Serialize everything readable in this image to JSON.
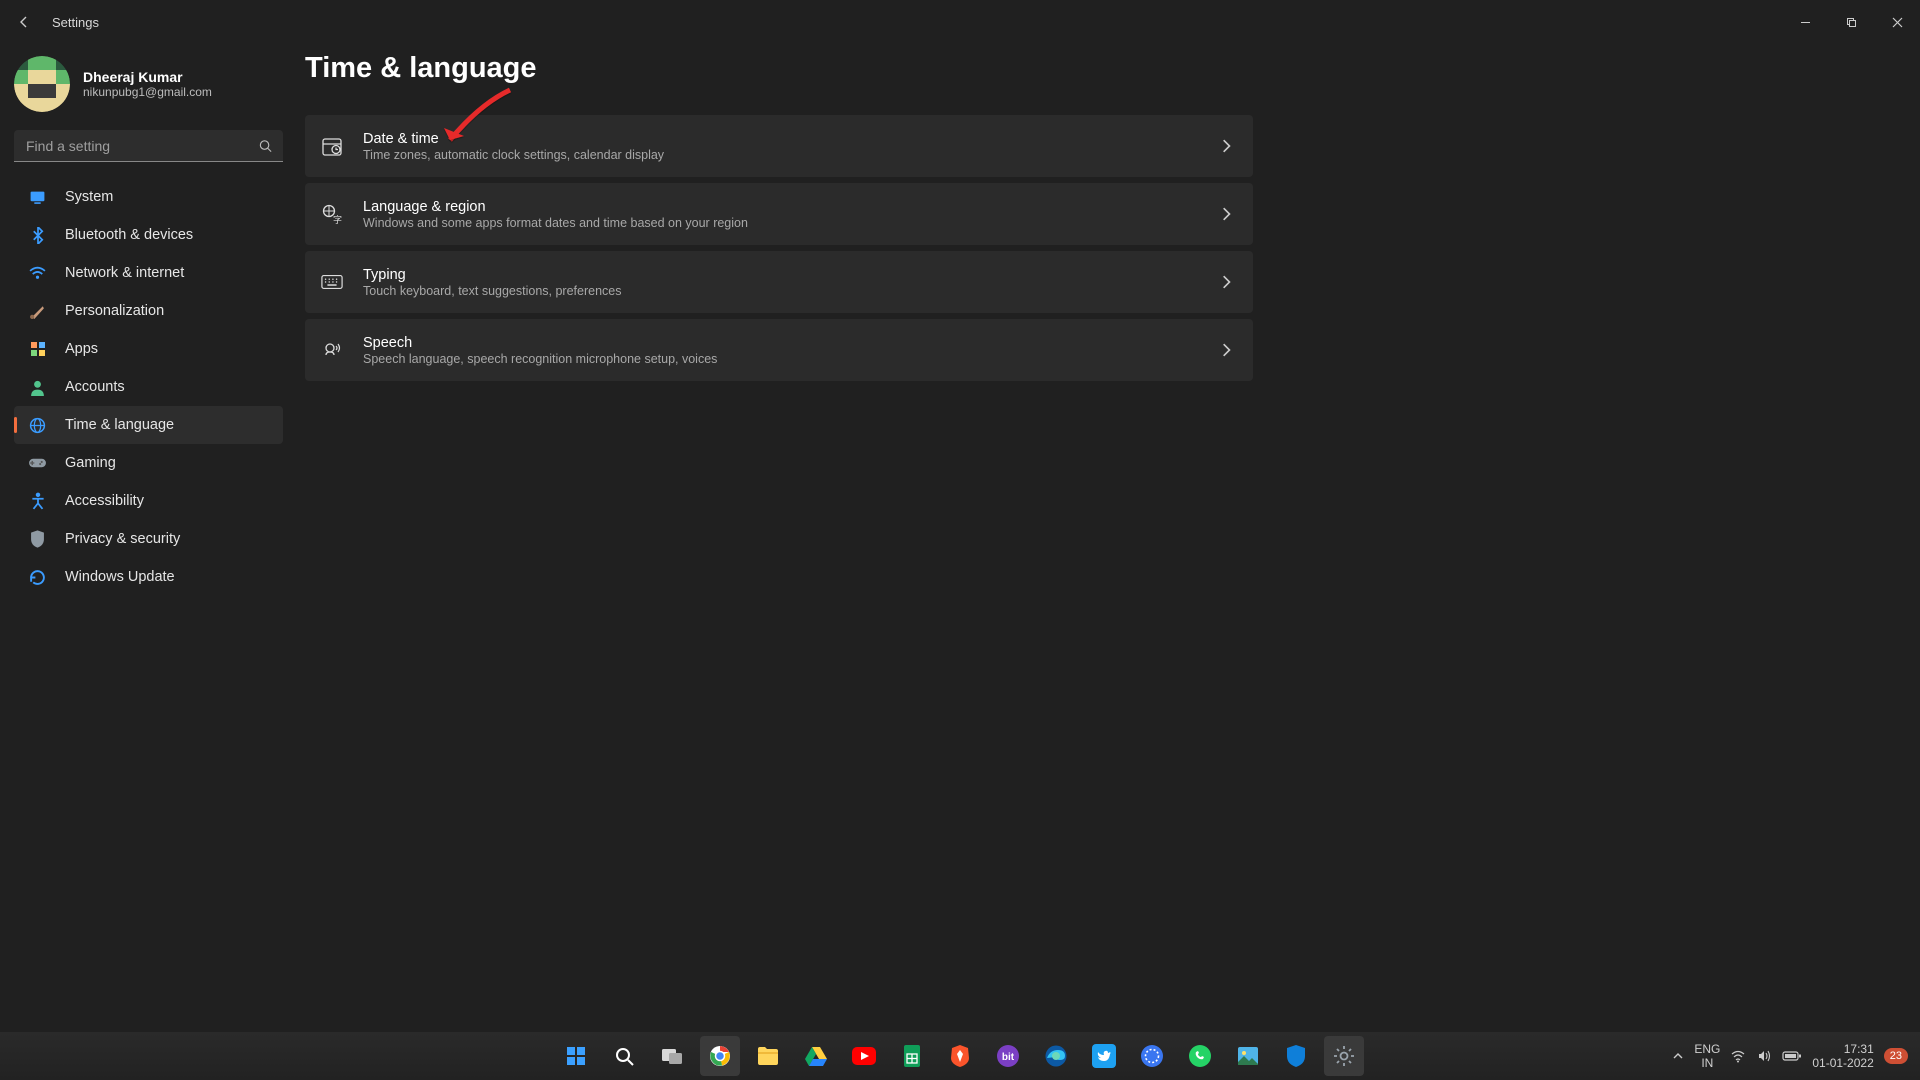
{
  "window": {
    "title": "Settings"
  },
  "user": {
    "name": "Dheeraj Kumar",
    "email": "nikunpubg1@gmail.com"
  },
  "search": {
    "placeholder": "Find a setting"
  },
  "nav": {
    "items": [
      {
        "label": "System",
        "icon": "monitor",
        "color": "#3b9cff"
      },
      {
        "label": "Bluetooth & devices",
        "icon": "bluetooth",
        "color": "#3b9cff"
      },
      {
        "label": "Network & internet",
        "icon": "wifi",
        "color": "#3b9cff"
      },
      {
        "label": "Personalization",
        "icon": "brush",
        "color": "#c89b7b"
      },
      {
        "label": "Apps",
        "icon": "grid",
        "color": "#ff9a5c"
      },
      {
        "label": "Accounts",
        "icon": "person",
        "color": "#52c58d"
      },
      {
        "label": "Time & language",
        "icon": "globe",
        "color": "#3b9cff",
        "active": true
      },
      {
        "label": "Gaming",
        "icon": "gamepad",
        "color": "#8f9aa3"
      },
      {
        "label": "Accessibility",
        "icon": "access",
        "color": "#3b9cff"
      },
      {
        "label": "Privacy & security",
        "icon": "shield",
        "color": "#8f9aa3"
      },
      {
        "label": "Windows Update",
        "icon": "update",
        "color": "#3b9cff"
      }
    ]
  },
  "page": {
    "title": "Time & language"
  },
  "cards": [
    {
      "title": "Date & time",
      "subtitle": "Time zones, automatic clock settings, calendar display",
      "icon": "calendar"
    },
    {
      "title": "Language & region",
      "subtitle": "Windows and some apps format dates and time based on your region",
      "icon": "lang"
    },
    {
      "title": "Typing",
      "subtitle": "Touch keyboard, text suggestions, preferences",
      "icon": "keyboard"
    },
    {
      "title": "Speech",
      "subtitle": "Speech language, speech recognition microphone setup, voices",
      "icon": "speech"
    }
  ],
  "taskbar": {
    "lang_top": "ENG",
    "lang_bottom": "IN",
    "time": "17:31",
    "date": "01-01-2022",
    "notif_count": "23"
  }
}
